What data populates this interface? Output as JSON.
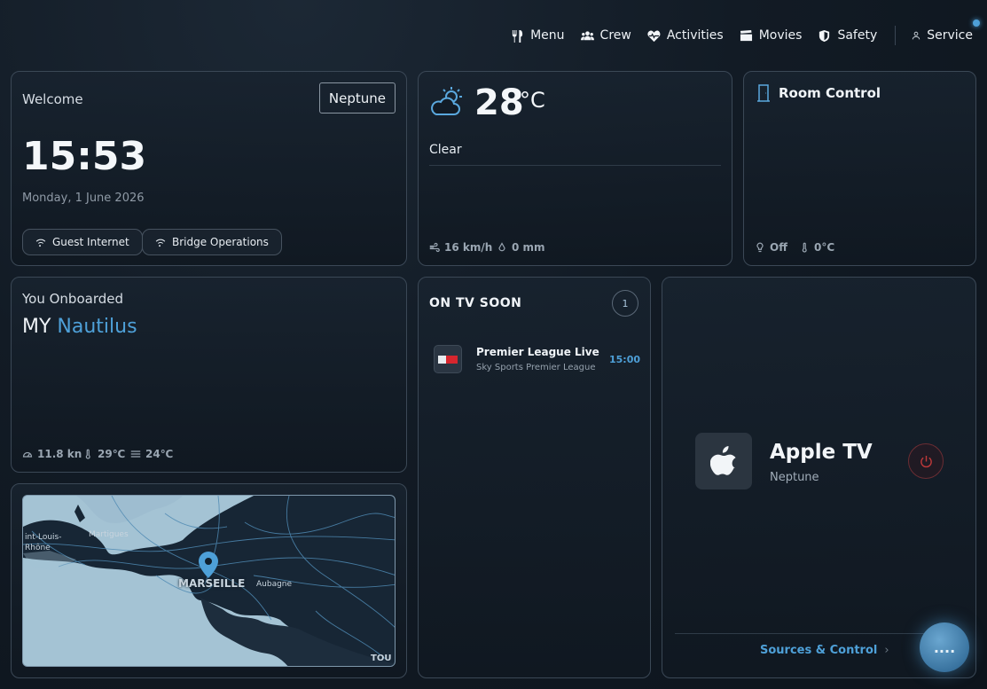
{
  "nav": {
    "menu": "Menu",
    "crew": "Crew",
    "activities": "Activities",
    "movies": "Movies",
    "safety": "Safety",
    "service": "Service"
  },
  "welcome": {
    "label": "Welcome",
    "location_button": "Neptune",
    "time": "15:53",
    "date": "Monday, 1 June 2026",
    "wifi_1": "Guest Internet",
    "wifi_2": "Bridge Operations"
  },
  "weather": {
    "temperature": "28",
    "unit": "°C",
    "condition": "Clear",
    "wind": "16 km/h",
    "rain": "0 mm"
  },
  "room": {
    "title": "Room Control",
    "light": "Off",
    "temp": "0°C"
  },
  "onboard": {
    "label": "You Onboarded",
    "prefix": "MY",
    "yacht": "Nautilus",
    "speed": "11.8 kn",
    "air_temp": "29℃",
    "water_temp": "24℃"
  },
  "map": {
    "city": "MARSEILLE",
    "town_1": "Aubagne",
    "town_2": "Martigues",
    "town_3": "int-Louis-",
    "town_3b": "Rhône",
    "town_4": "TOU"
  },
  "tv": {
    "title": "ON TV SOON",
    "count": "1",
    "items": [
      {
        "title": "Premier League Live",
        "channel": "Sky Sports Premier League",
        "time": "15:00"
      }
    ]
  },
  "apple_tv": {
    "name": "Apple TV",
    "room": "Neptune",
    "sources_link": "Sources & Control",
    "fab_label": "...."
  },
  "colors": {
    "accent": "#4ea0d8",
    "power": "#c0393a",
    "background": "#121b25"
  }
}
